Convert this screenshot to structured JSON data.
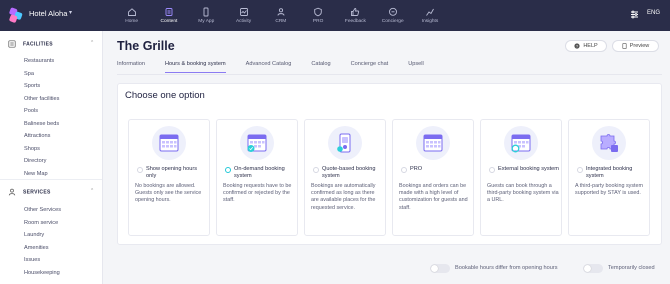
{
  "brand": {
    "hotel_name": "Hotel Aloha",
    "accent": "#8b7bf2",
    "topbar_color": "#2a2d49"
  },
  "nav": {
    "items": [
      {
        "label": "Home",
        "icon": "home-icon"
      },
      {
        "label": "Content",
        "icon": "content-icon",
        "active": true
      },
      {
        "label": "My App",
        "icon": "phone-icon"
      },
      {
        "label": "Activity",
        "icon": "activity-icon"
      },
      {
        "label": "CRM",
        "icon": "people-icon"
      },
      {
        "label": "PRO",
        "icon": "shield-icon"
      },
      {
        "label": "Feedback",
        "icon": "thumb-icon"
      },
      {
        "label": "Concierge",
        "icon": "chat-icon"
      },
      {
        "label": "Insights",
        "icon": "chart-icon"
      }
    ],
    "language": "ENG"
  },
  "sidebar": {
    "facilities": {
      "title": "FACILITIES",
      "items": [
        "Restaurants",
        "Spa",
        "Sports",
        "Other facilities",
        "Pools",
        "Balinese beds",
        "Attractions",
        "Shops",
        "Directory",
        "New Map"
      ]
    },
    "services": {
      "title": "SERVICES",
      "items": [
        "Other Services",
        "Room service",
        "Laundry",
        "Amenities",
        "Issues",
        "Housekeeping"
      ]
    }
  },
  "page": {
    "title": "The Grille",
    "help_label": "HELP",
    "preview_label": "Preview",
    "tabs": [
      "Information",
      "Hours & booking system",
      "Advanced Catalog",
      "Catalog",
      "Concierge chat",
      "Upsell"
    ],
    "active_tab": "Hours & booking system"
  },
  "options_panel": {
    "title": "Choose one option",
    "options": [
      {
        "title": "Show opening hours only",
        "description": "No bookings are allowed. Guests only see the service opening hours.",
        "selected": false,
        "icon": "calendar-icon"
      },
      {
        "title": "On-demand booking system",
        "description": "Booking requests have to be confirmed or rejected by the staff.",
        "selected": true,
        "icon": "calendar-check-icon"
      },
      {
        "title": "Quote-based booking system",
        "description": "Bookings are automatically confirmed as long as there are available places for the requested service.",
        "selected": false,
        "icon": "phone-booking-icon"
      },
      {
        "title": "PRO",
        "description": "Bookings and orders can be made with a high level of customization for guests and staff.",
        "selected": false,
        "icon": "calendar-pro-icon"
      },
      {
        "title": "External booking system",
        "description": "Guests can book through a third-party booking system via a URL.",
        "selected": false,
        "icon": "calendar-link-icon"
      },
      {
        "title": "Integrated booking system",
        "description": "A third-party booking system supported by STAY is used.",
        "selected": false,
        "icon": "puzzle-icon"
      }
    ]
  },
  "toggles": {
    "bookable_hours": "Bookable hours differ from opening hours",
    "temporarily_closed": "Temporarily closed"
  }
}
